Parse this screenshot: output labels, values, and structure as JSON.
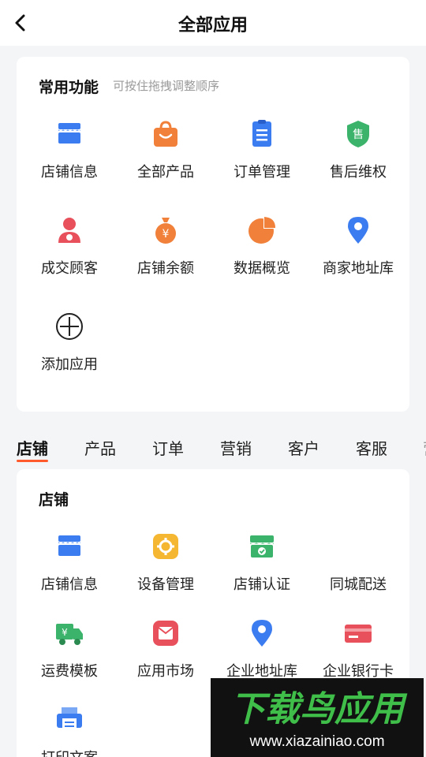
{
  "nav": {
    "title": "全部应用"
  },
  "common": {
    "title": "常用功能",
    "hint": "可按住拖拽调整顺序",
    "apps": [
      {
        "label": "店铺信息",
        "icon": "store-icon"
      },
      {
        "label": "全部产品",
        "icon": "shopping-bag-icon"
      },
      {
        "label": "订单管理",
        "icon": "clipboard-icon"
      },
      {
        "label": "售后维权",
        "icon": "after-sales-shield-icon"
      },
      {
        "label": "成交顾客",
        "icon": "customer-icon"
      },
      {
        "label": "店铺余额",
        "icon": "money-bag-icon"
      },
      {
        "label": "数据概览",
        "icon": "pie-chart-icon"
      },
      {
        "label": "商家地址库",
        "icon": "location-pin-icon"
      },
      {
        "label": "添加应用",
        "icon": "add-circle-icon"
      }
    ]
  },
  "tabs": [
    "店铺",
    "产品",
    "订单",
    "营销",
    "客户",
    "客服",
    "营"
  ],
  "store": {
    "title": "店铺",
    "apps": [
      {
        "label": "店铺信息",
        "icon": "store-icon"
      },
      {
        "label": "设备管理",
        "icon": "gear-icon"
      },
      {
        "label": "店铺认证",
        "icon": "store-verified-icon"
      },
      {
        "label": "同城配送",
        "icon": "delivery-icon"
      },
      {
        "label": "运费模板",
        "icon": "freight-truck-icon"
      },
      {
        "label": "应用市场",
        "icon": "app-market-icon"
      },
      {
        "label": "企业地址库",
        "icon": "location-pin-icon"
      },
      {
        "label": "企业银行卡",
        "icon": "bank-card-icon"
      },
      {
        "label": "打印文案",
        "icon": "printer-icon"
      }
    ]
  },
  "watermark": {
    "logo_text": "下载鸟应用",
    "url": "www.xiazainiao.com"
  },
  "colors": {
    "accent": "#ff5a2c",
    "blue": "#3b7cf0",
    "orange": "#f0803a",
    "green": "#3bb36b",
    "red": "#e8505b"
  }
}
